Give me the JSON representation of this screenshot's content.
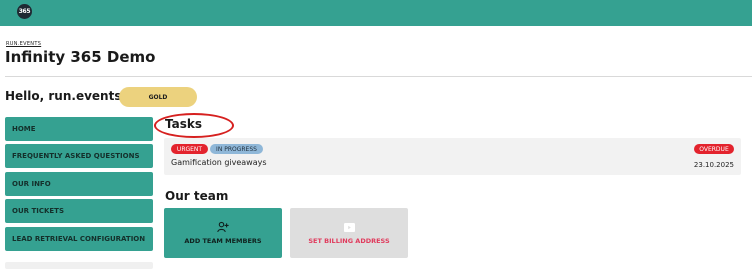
{
  "app": {
    "logo_text": "365",
    "breadcrumb": "RUN.EVENTS",
    "title": "Infinity 365 Demo"
  },
  "header": {
    "greeting": "Hello, run.events! :)",
    "tier_badge": "GOLD"
  },
  "sidebar": {
    "items": [
      {
        "label": "HOME"
      },
      {
        "label": "FREQUENTLY ASKED QUESTIONS"
      },
      {
        "label": "OUR INFO"
      },
      {
        "label": "OUR TICKETS"
      },
      {
        "label": "LEAD RETRIEVAL CONFIGURATION"
      }
    ]
  },
  "tasks": {
    "heading": "Tasks",
    "items": [
      {
        "tags": [
          "URGENT",
          "IN PROGRESS"
        ],
        "status": "OVERDUE",
        "name": "Gamification giveaways",
        "date": "23.10.2025"
      }
    ]
  },
  "team": {
    "heading": "Our team",
    "actions": [
      {
        "label": "ADD TEAM MEMBERS",
        "icon": "add-user-icon"
      },
      {
        "label": "SET BILLING ADDRESS",
        "icon": "billing-icon"
      }
    ]
  },
  "colors": {
    "brand_teal": "#35a191",
    "gold": "#ecd27e",
    "urgent_red": "#e3232d",
    "in_progress_blue": "#8fb7d8",
    "annotation_red": "#d6201f",
    "billing_pink": "#e03a5c"
  }
}
